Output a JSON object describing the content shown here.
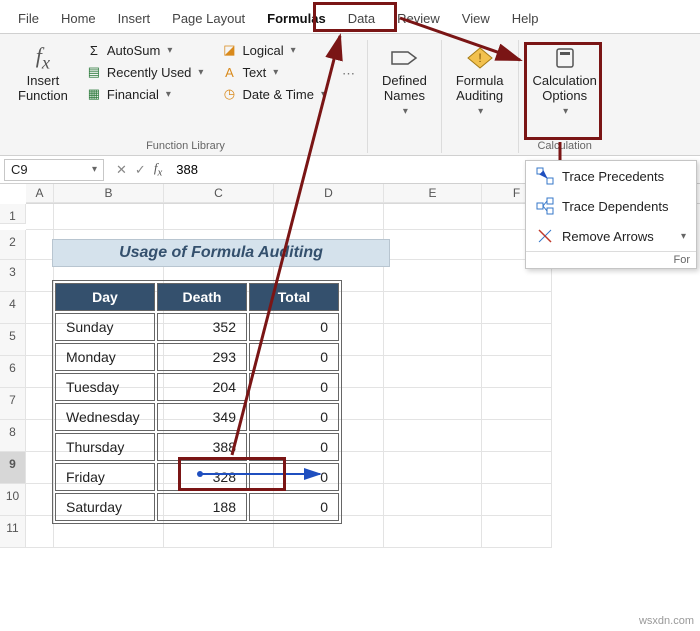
{
  "tabs": [
    "File",
    "Home",
    "Insert",
    "Page Layout",
    "Formulas",
    "Data",
    "Review",
    "View",
    "Help"
  ],
  "active_tab": 4,
  "ribbon": {
    "insert_function": "Insert\nFunction",
    "autosum": "AutoSum",
    "recent": "Recently Used",
    "financial": "Financial",
    "logical": "Logical",
    "text": "Text",
    "datetime": "Date & Time",
    "function_library": "Function Library",
    "defined_names": "Defined\nNames",
    "formula_auditing": "Formula\nAuditing",
    "calc_options": "Calculation\nOptions",
    "calculation": "Calculation"
  },
  "namebox": "C9",
  "formula_value": "388",
  "menu": {
    "trace_precedents": "Trace Precedents",
    "trace_dependents": "Trace Dependents",
    "remove_arrows": "Remove Arrows",
    "footer": "For"
  },
  "columns": [
    "A",
    "B",
    "C",
    "D",
    "E",
    "F"
  ],
  "row_headers": [
    1,
    2,
    3,
    4,
    5,
    6,
    7,
    8,
    9,
    10,
    11
  ],
  "title": "Usage of Formula Auditing",
  "table": {
    "headers": [
      "Day",
      "Death",
      "Total"
    ],
    "rows": [
      {
        "day": "Sunday",
        "death": 352,
        "total": 0
      },
      {
        "day": "Monday",
        "death": 293,
        "total": 0
      },
      {
        "day": "Tuesday",
        "death": 204,
        "total": 0
      },
      {
        "day": "Wednesday",
        "death": 349,
        "total": 0
      },
      {
        "day": "Thursday",
        "death": 388,
        "total": 0
      },
      {
        "day": "Friday",
        "death": 328,
        "total": 0
      },
      {
        "day": "Saturday",
        "death": 188,
        "total": 0
      }
    ]
  },
  "watermark": "wsxdn.com"
}
